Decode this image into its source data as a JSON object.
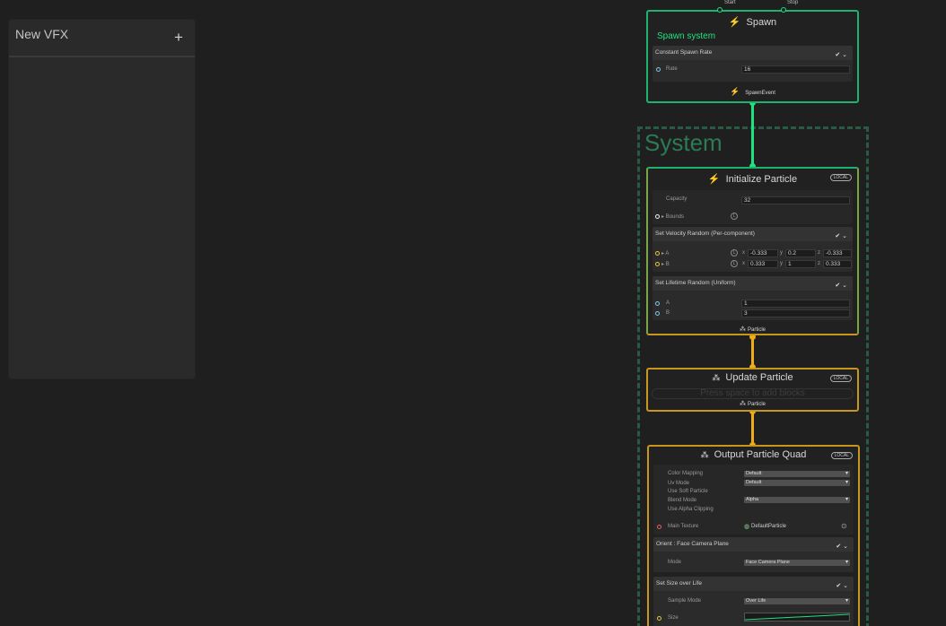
{
  "blackboard": {
    "title": "New VFX",
    "add": "+"
  },
  "spawn": {
    "start_label": "Start",
    "stop_label": "Stop",
    "title": "Spawn",
    "subtitle": "Spawn system",
    "block_title": "Constant Spawn Rate",
    "rate_label": "Rate",
    "rate_value": "16",
    "event_label": "SpawnEvent"
  },
  "system": {
    "title": "System"
  },
  "initialize": {
    "title": "Initialize Particle",
    "local": "LOCAL",
    "capacity_label": "Capacity",
    "capacity_value": "32",
    "bounds_label": "Bounds",
    "vel_title": "Set Velocity Random (Per-component)",
    "a_label": "A",
    "b_label": "B",
    "a_x": "-0.333",
    "a_y": "0.2",
    "a_z": "-0.333",
    "b_x": "0.333",
    "b_y": "1",
    "b_z": "0.333",
    "x": "x",
    "y": "y",
    "z": "z",
    "life_title": "Set Lifetime Random (Uniform)",
    "life_a": "1",
    "life_b": "3",
    "out_label": "Particle"
  },
  "update": {
    "title": "Update Particle",
    "local": "LOCAL",
    "placeholder": "Press space to add blocks",
    "out_label": "Particle"
  },
  "output": {
    "title": "Output Particle Quad",
    "local": "LOCAL",
    "color_mapping_label": "Color Mapping",
    "color_mapping_value": "Default",
    "uv_mode_label": "Uv Mode",
    "uv_mode_value": "Default",
    "soft_particle_label": "Use Soft Particle",
    "blend_mode_label": "Blend Mode",
    "blend_mode_value": "Alpha",
    "alpha_clip_label": "Use Alpha Clipping",
    "main_texture_label": "Main Texture",
    "main_texture_value": "DefaultParticle",
    "orient_title": "Orient : Face Camera Plane",
    "mode_label": "Mode",
    "mode_value": "Face Camera Plane",
    "size_title": "Set Size over Life",
    "sample_mode_label": "Sample Mode",
    "sample_mode_value": "Over Life",
    "size_label": "Size"
  },
  "colors": {
    "green": "#1ee37f",
    "orange": "#f0ad1a",
    "system": "#2c7a56"
  }
}
